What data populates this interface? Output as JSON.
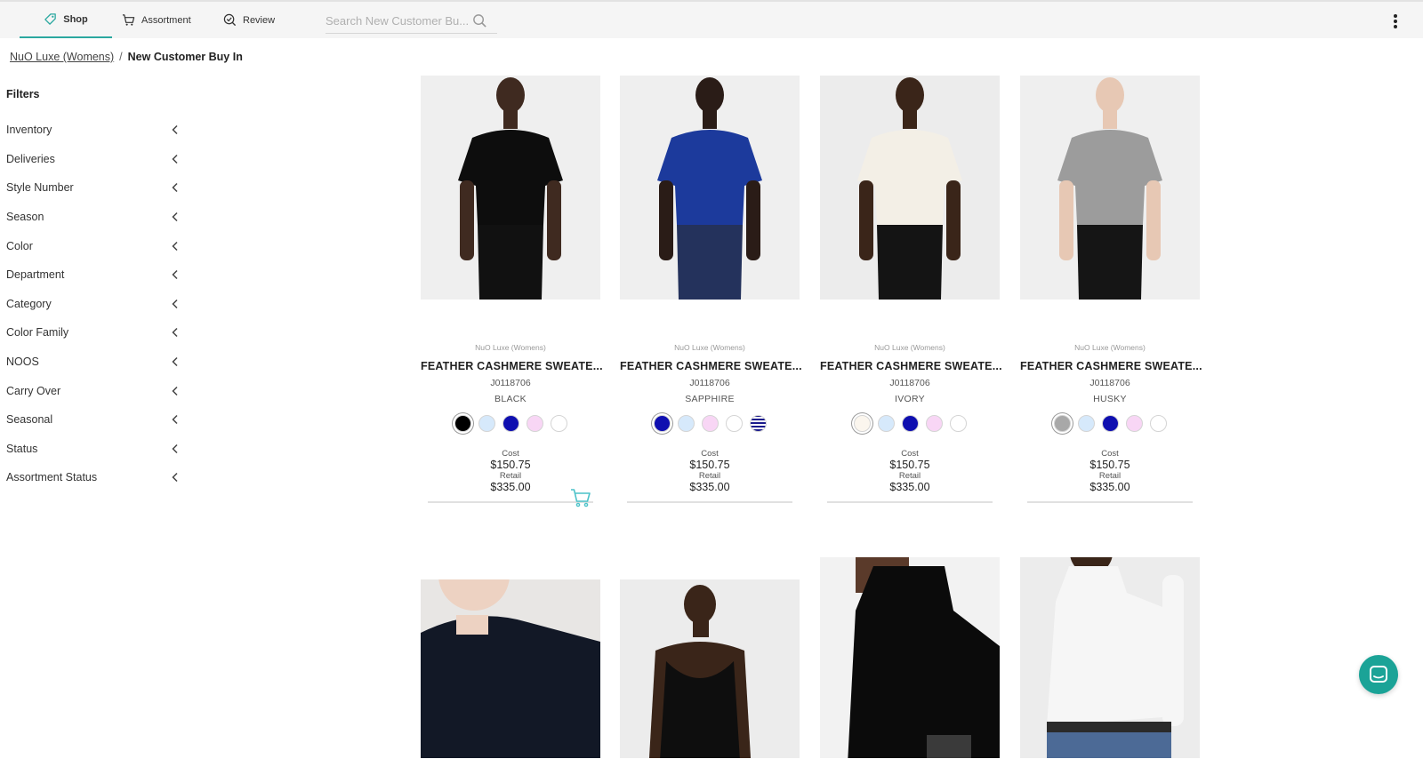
{
  "nav": {
    "tabs": [
      {
        "label": "Shop",
        "icon": "tag-icon",
        "active": true
      },
      {
        "label": "Assortment",
        "icon": "cart-icon",
        "active": false
      },
      {
        "label": "Review",
        "icon": "review-check-icon",
        "active": false
      }
    ],
    "search_placeholder": "Search New Customer Bu..."
  },
  "breadcrumb": {
    "link": "NuO Luxe (Womens)",
    "separator": "/",
    "current": "New Customer Buy In"
  },
  "filters": {
    "title": "Filters",
    "items": [
      "Inventory",
      "Deliveries",
      "Style Number",
      "Season",
      "Color",
      "Department",
      "Category",
      "Color Family",
      "NOOS",
      "Carry Over",
      "Seasonal",
      "Status",
      "Assortment Status"
    ]
  },
  "products": [
    {
      "brand": "NuO Luxe (Womens)",
      "name": "FEATHER CASHMERE SWEATE...",
      "style": "J0118706",
      "color": "BLACK",
      "swatches": [
        "#000000",
        "#d6e9fb",
        "#0f0fb0",
        "#f8d6f5",
        "#ffffff"
      ],
      "selected": 0,
      "cost_label": "Cost",
      "cost": "$150.75",
      "retail_label": "Retail",
      "retail": "$335.00",
      "garment": "#0d0d0d",
      "skin": "#3f2a20",
      "bottom": "#111111",
      "bg": "#efefef"
    },
    {
      "brand": "NuO Luxe (Womens)",
      "name": "FEATHER CASHMERE SWEATE...",
      "style": "J0118706",
      "color": "SAPPHIRE",
      "swatches": [
        "#0f0fb0",
        "#d6e9fb",
        "#f8d6f5",
        "#ffffff",
        "stripe"
      ],
      "selected": 0,
      "cost_label": "Cost",
      "cost": "$150.75",
      "retail_label": "Retail",
      "retail": "$335.00",
      "garment": "#1c3a9c",
      "skin": "#2a1c17",
      "bottom": "#24325c",
      "bg": "#efefef"
    },
    {
      "brand": "NuO Luxe (Womens)",
      "name": "FEATHER CASHMERE SWEATE...",
      "style": "J0118706",
      "color": "IVORY",
      "swatches": [
        "#fbf6ee",
        "#d6e9fb",
        "#0f0fb0",
        "#f8d6f5",
        "#ffffff"
      ],
      "selected": 0,
      "cost_label": "Cost",
      "cost": "$150.75",
      "retail_label": "Retail",
      "retail": "$335.00",
      "garment": "#f3efe6",
      "skin": "#3a2519",
      "bottom": "#141414",
      "bg": "#ececec"
    },
    {
      "brand": "NuO Luxe (Womens)",
      "name": "FEATHER CASHMERE SWEATE...",
      "style": "J0118706",
      "color": "HUSKY",
      "swatches": [
        "#a8a8a8",
        "#d6e9fb",
        "#0f0fb0",
        "#f8d6f5",
        "#ffffff"
      ],
      "selected": 0,
      "cost_label": "Cost",
      "cost": "$150.75",
      "retail_label": "Retail",
      "retail": "$335.00",
      "garment": "#9c9c9c",
      "skin": "#e7c8b4",
      "bottom": "#151515",
      "bg": "#efefef"
    }
  ],
  "products_row2": [
    {
      "garment": "#121826",
      "skin": "#edd2c2",
      "bg": "#e8e6e4"
    },
    {
      "garment": "#0e0e0e",
      "skin": "#3a2519",
      "bg": "#ececec"
    },
    {
      "garment": "#0b0b0b",
      "skin": "#5a3a2a",
      "bg": "#f2f2f2"
    },
    {
      "garment": "#f6f6f6",
      "skin": "#3a2519",
      "bg": "#ececec"
    }
  ],
  "colors": {
    "accent": "#2ba8a0",
    "chat": "#1ba397"
  }
}
